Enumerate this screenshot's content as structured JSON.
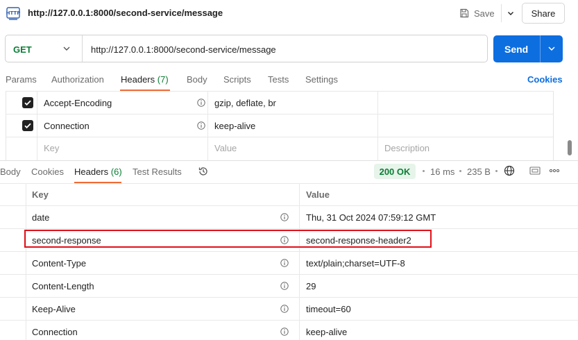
{
  "header": {
    "title": "http://127.0.0.1:8000/second-service/message",
    "save_label": "Save",
    "share_label": "Share"
  },
  "request": {
    "method": "GET",
    "url": "http://127.0.0.1:8000/second-service/message",
    "send_label": "Send"
  },
  "request_tabs": {
    "items": [
      {
        "label": "Params"
      },
      {
        "label": "Authorization"
      },
      {
        "label": "Headers",
        "count": "(7)"
      },
      {
        "label": "Body"
      },
      {
        "label": "Scripts"
      },
      {
        "label": "Tests"
      },
      {
        "label": "Settings"
      }
    ],
    "active": "Headers",
    "cookies_label": "Cookies"
  },
  "request_headers": {
    "rows": [
      {
        "checked": true,
        "key": "Accept-Encoding",
        "value": "gzip, deflate, br"
      },
      {
        "checked": true,
        "key": "Connection",
        "value": "keep-alive"
      }
    ],
    "placeholders": {
      "key": "Key",
      "value": "Value",
      "description": "Description"
    }
  },
  "response": {
    "tabs": [
      {
        "label": "Body"
      },
      {
        "label": "Cookies"
      },
      {
        "label": "Headers",
        "count": "(6)"
      },
      {
        "label": "Test Results"
      }
    ],
    "active": "Headers",
    "status": "200 OK",
    "time": "16 ms",
    "size": "235 B",
    "table_headers": {
      "key": "Key",
      "value": "Value"
    },
    "headers": [
      {
        "key": "date",
        "value": "Thu, 31 Oct 2024 07:59:12 GMT"
      },
      {
        "key": "second-response",
        "value": "second-response-header2",
        "highlighted": true
      },
      {
        "key": "Content-Type",
        "value": "text/plain;charset=UTF-8"
      },
      {
        "key": "Content-Length",
        "value": "29"
      },
      {
        "key": "Keep-Alive",
        "value": "timeout=60"
      },
      {
        "key": "Connection",
        "value": "keep-alive"
      }
    ]
  },
  "colors": {
    "accent": "#0d6ee0",
    "tab_underline": "#ef6c35",
    "method_green": "#0a7e35",
    "status_bg": "#e6f4ea",
    "highlight": "#e0101a"
  },
  "icons": [
    "http-icon",
    "save-icon",
    "chevron-down-icon",
    "info-icon",
    "history-icon",
    "globe-icon",
    "screenshot-icon",
    "more-icon",
    "checkbox-icon"
  ]
}
